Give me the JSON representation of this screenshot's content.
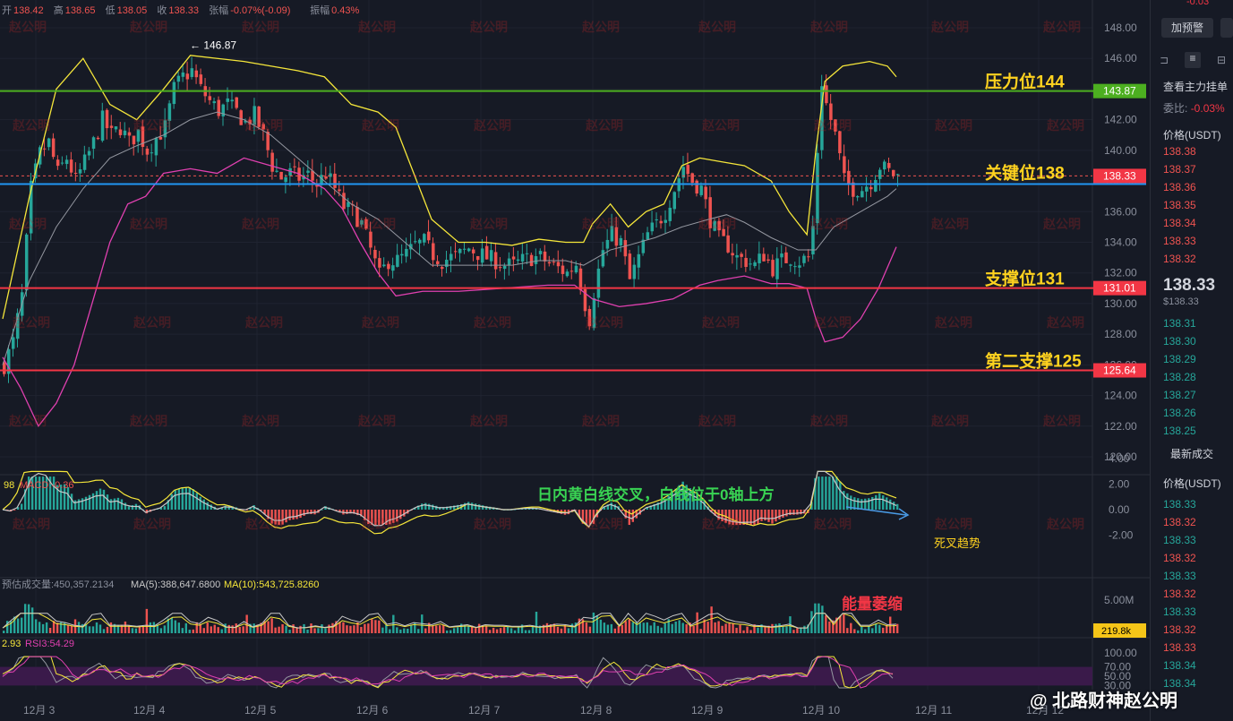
{
  "header": {
    "ohlc": [
      {
        "k": "开",
        "v": "138.42"
      },
      {
        "k": "高",
        "v": "138.65"
      },
      {
        "k": "低",
        "v": "138.05"
      },
      {
        "k": "收",
        "v": "138.33"
      },
      {
        "k": "张幅",
        "v": "-0.07%(-0.09)"
      },
      {
        "k": "振幅",
        "v": "0.43%"
      }
    ],
    "max_label": "146.87"
  },
  "annotations": {
    "resistance": "压力位144",
    "key": "关键位138",
    "support": "支撑位131",
    "support2": "第二支撑125",
    "macd_note": "日内黄白线交叉，白线位于0轴上方",
    "macd_death": "死叉趋势",
    "volume_note": "能量萎缩"
  },
  "price_axis": {
    "ticks": [
      "148.00",
      "146.00",
      "144.00",
      "142.00",
      "140.00",
      "138.00",
      "136.00",
      "134.00",
      "132.00",
      "130.00",
      "128.00",
      "126.00",
      "124.00",
      "122.00",
      "120.00"
    ],
    "tags": {
      "resistance": "143.87",
      "key": "138.33",
      "support": "131.01",
      "support2": "125.64"
    }
  },
  "macd": {
    "label_left": "98",
    "label": "MACD:-0.36",
    "ticks": [
      "4.00",
      "2.00",
      "0.00",
      "-2.00"
    ]
  },
  "volume": {
    "label_left": "预估成交量:450,357.2134",
    "ma5": "MA(5):388,647.6800",
    "ma10": "MA(10):543,725.8260",
    "ticks": [
      "5.00M"
    ],
    "tag": "219.8k"
  },
  "rsi": {
    "label_left": "2.93",
    "label": "RSI3:54.29",
    "ticks": [
      "100.00",
      "70.00",
      "50.00",
      "30.00"
    ]
  },
  "x_axis": [
    "12月 3",
    "12月 4",
    "12月 5",
    "12月 6",
    "12月 7",
    "12月 8",
    "12月 9",
    "12月 10",
    "12月 11",
    "12月 12"
  ],
  "watermark": "赵公明",
  "watermark_bottom": "@ 北路财神赵公明",
  "side": {
    "top_text": "-0.03",
    "alert_btn": "加预警",
    "depth_title": "查看主力挂单",
    "ratio_label": "委比:",
    "ratio_value": "-0.03%",
    "price_hdr": "价格(USDT)",
    "asks": [
      "138.38",
      "138.37",
      "138.36",
      "138.35",
      "138.34",
      "138.33",
      "138.32"
    ],
    "last": "138.33",
    "last_usd": "$138.33",
    "bids": [
      "138.31",
      "138.30",
      "138.29",
      "138.28",
      "138.27",
      "138.26",
      "138.25"
    ],
    "trades_title": "最新成交",
    "trades_hdr": "价格(USDT)",
    "trades": [
      {
        "p": "138.33",
        "c": "g"
      },
      {
        "p": "138.32",
        "c": "r"
      },
      {
        "p": "138.33",
        "c": "g"
      },
      {
        "p": "138.32",
        "c": "r"
      },
      {
        "p": "138.33",
        "c": "g"
      },
      {
        "p": "138.32",
        "c": "r"
      },
      {
        "p": "138.33",
        "c": "g"
      },
      {
        "p": "138.32",
        "c": "r"
      },
      {
        "p": "138.33",
        "c": "r"
      },
      {
        "p": "138.34",
        "c": "g"
      },
      {
        "p": "138.34",
        "c": "g"
      }
    ]
  },
  "chart_data": {
    "type": "candlestick",
    "y_range": [
      119,
      149
    ],
    "levels": [
      {
        "name": "压力位144",
        "value": 143.87,
        "color": "#4caf20"
      },
      {
        "name": "关键位138",
        "value": 137.8,
        "color": "#2196f3"
      },
      {
        "name": "支撑位131",
        "value": 131.01,
        "color": "#f23645"
      },
      {
        "name": "第二支撑125",
        "value": 125.64,
        "color": "#f23645"
      }
    ],
    "price_path": [
      [
        0,
        126.0
      ],
      [
        10,
        127.5
      ],
      [
        20,
        130.5
      ],
      [
        30,
        137.5
      ],
      [
        40,
        139.8
      ],
      [
        50,
        140.5
      ],
      [
        60,
        138.5
      ],
      [
        70,
        139.5
      ],
      [
        80,
        138.0
      ],
      [
        90,
        139.2
      ],
      [
        100,
        140.5
      ],
      [
        110,
        142.0
      ],
      [
        120,
        141.0
      ],
      [
        130,
        141.5
      ],
      [
        140,
        140.5
      ],
      [
        150,
        141.2
      ],
      [
        160,
        140.0
      ],
      [
        170,
        140.8
      ],
      [
        180,
        141.5
      ],
      [
        190,
        144.0
      ],
      [
        200,
        144.8
      ],
      [
        210,
        145.2
      ],
      [
        220,
        144.0
      ],
      [
        230,
        143.2
      ],
      [
        240,
        142.6
      ],
      [
        250,
        143.0
      ],
      [
        260,
        142.5
      ],
      [
        270,
        141.8
      ],
      [
        280,
        142.3
      ],
      [
        290,
        141.0
      ],
      [
        300,
        139.0
      ],
      [
        310,
        138.2
      ],
      [
        320,
        138.5
      ],
      [
        330,
        138.2
      ],
      [
        340,
        138.4
      ],
      [
        350,
        137.8
      ],
      [
        360,
        138.5
      ],
      [
        370,
        137.5
      ],
      [
        380,
        136.3
      ],
      [
        390,
        136.0
      ],
      [
        400,
        135.2
      ],
      [
        410,
        133.5
      ],
      [
        420,
        131.8
      ],
      [
        430,
        132.8
      ],
      [
        440,
        132.8
      ],
      [
        450,
        133.2
      ],
      [
        460,
        133.8
      ],
      [
        470,
        134.0
      ],
      [
        480,
        133.2
      ],
      [
        490,
        132.8
      ],
      [
        500,
        133.0
      ],
      [
        510,
        133.2
      ],
      [
        520,
        133.6
      ],
      [
        530,
        133.3
      ],
      [
        540,
        133.0
      ],
      [
        550,
        132.8
      ],
      [
        560,
        132.5
      ],
      [
        570,
        132.5
      ],
      [
        580,
        132.8
      ],
      [
        590,
        133.0
      ],
      [
        600,
        133.0
      ],
      [
        610,
        132.6
      ],
      [
        620,
        132.3
      ],
      [
        630,
        132.0
      ],
      [
        640,
        132.6
      ],
      [
        650,
        130.0
      ],
      [
        655,
        129.0
      ],
      [
        660,
        130.8
      ],
      [
        670,
        133.5
      ],
      [
        680,
        134.5
      ],
      [
        690,
        134.0
      ],
      [
        700,
        131.5
      ],
      [
        710,
        133.0
      ],
      [
        720,
        134.5
      ],
      [
        730,
        135.2
      ],
      [
        740,
        136.0
      ],
      [
        750,
        137.5
      ],
      [
        760,
        139.0
      ],
      [
        770,
        138.0
      ],
      [
        780,
        137.5
      ],
      [
        790,
        135.5
      ],
      [
        800,
        134.2
      ],
      [
        810,
        133.8
      ],
      [
        820,
        133.0
      ],
      [
        830,
        132.8
      ],
      [
        840,
        132.5
      ],
      [
        850,
        133.2
      ],
      [
        860,
        132.3
      ],
      [
        870,
        132.8
      ],
      [
        880,
        133.0
      ],
      [
        890,
        132.8
      ],
      [
        900,
        133.0
      ],
      [
        905,
        135.0
      ],
      [
        910,
        140.0
      ],
      [
        915,
        144.5
      ],
      [
        920,
        143.0
      ],
      [
        930,
        141.0
      ],
      [
        940,
        138.0
      ],
      [
        950,
        137.5
      ],
      [
        960,
        137.5
      ],
      [
        970,
        138.0
      ],
      [
        980,
        139.0
      ],
      [
        990,
        138.6
      ],
      [
        1000,
        138.3
      ]
    ],
    "bb_upper": [
      [
        0,
        129
      ],
      [
        30,
        137
      ],
      [
        60,
        144
      ],
      [
        90,
        146
      ],
      [
        120,
        143
      ],
      [
        150,
        142
      ],
      [
        180,
        144
      ],
      [
        210,
        146.2
      ],
      [
        240,
        146
      ],
      [
        270,
        145.8
      ],
      [
        300,
        145.5
      ],
      [
        330,
        145.2
      ],
      [
        360,
        144.8
      ],
      [
        390,
        143
      ],
      [
        420,
        142.5
      ],
      [
        440,
        141.5
      ],
      [
        460,
        138.5
      ],
      [
        480,
        135.5
      ],
      [
        510,
        134.0
      ],
      [
        540,
        134.0
      ],
      [
        570,
        133.8
      ],
      [
        600,
        134.2
      ],
      [
        630,
        134.0
      ],
      [
        650,
        134.0
      ],
      [
        660,
        135.2
      ],
      [
        680,
        136.5
      ],
      [
        700,
        135.0
      ],
      [
        720,
        136.0
      ],
      [
        740,
        136.5
      ],
      [
        760,
        139.0
      ],
      [
        780,
        139.5
      ],
      [
        800,
        139.3
      ],
      [
        830,
        139.0
      ],
      [
        860,
        138.0
      ],
      [
        880,
        136.0
      ],
      [
        900,
        134.5
      ],
      [
        910,
        140.0
      ],
      [
        920,
        144.5
      ],
      [
        940,
        145.5
      ],
      [
        970,
        145.8
      ],
      [
        990,
        145.5
      ],
      [
        1000,
        144.8
      ]
    ],
    "bb_lower": [
      [
        0,
        126.5
      ],
      [
        20,
        124.5
      ],
      [
        40,
        122.0
      ],
      [
        60,
        123.5
      ],
      [
        80,
        126.0
      ],
      [
        100,
        130.0
      ],
      [
        120,
        134.0
      ],
      [
        140,
        136.5
      ],
      [
        160,
        137.0
      ],
      [
        180,
        138.5
      ],
      [
        210,
        138.8
      ],
      [
        240,
        138.5
      ],
      [
        270,
        139.5
      ],
      [
        300,
        139.0
      ],
      [
        330,
        138.5
      ],
      [
        360,
        137.5
      ],
      [
        380,
        136.2
      ],
      [
        400,
        134.0
      ],
      [
        420,
        132.0
      ],
      [
        440,
        130.5
      ],
      [
        470,
        130.8
      ],
      [
        510,
        130.8
      ],
      [
        560,
        131.0
      ],
      [
        610,
        131.2
      ],
      [
        640,
        131.2
      ],
      [
        660,
        130.3
      ],
      [
        690,
        129.8
      ],
      [
        720,
        130.0
      ],
      [
        750,
        130.3
      ],
      [
        780,
        131.2
      ],
      [
        800,
        131.5
      ],
      [
        830,
        131.8
      ],
      [
        860,
        131.3
      ],
      [
        880,
        131.3
      ],
      [
        900,
        131.0
      ],
      [
        910,
        129.0
      ],
      [
        920,
        127.5
      ],
      [
        940,
        127.8
      ],
      [
        960,
        129.0
      ],
      [
        980,
        131.0
      ],
      [
        1000,
        133.7
      ]
    ],
    "bb_mid": [
      [
        0,
        126.0
      ],
      [
        30,
        131.5
      ],
      [
        60,
        135.0
      ],
      [
        90,
        137.5
      ],
      [
        120,
        139.5
      ],
      [
        150,
        140.3
      ],
      [
        180,
        141.0
      ],
      [
        210,
        142.0
      ],
      [
        240,
        142.5
      ],
      [
        270,
        142.0
      ],
      [
        300,
        141.0
      ],
      [
        330,
        139.5
      ],
      [
        360,
        138.0
      ],
      [
        390,
        136.5
      ],
      [
        420,
        135.5
      ],
      [
        450,
        134.0
      ],
      [
        480,
        132.5
      ],
      [
        510,
        132.5
      ],
      [
        540,
        132.5
      ],
      [
        570,
        132.5
      ],
      [
        600,
        132.8
      ],
      [
        630,
        132.8
      ],
      [
        650,
        132.5
      ],
      [
        680,
        133.5
      ],
      [
        700,
        133.8
      ],
      [
        730,
        134.3
      ],
      [
        760,
        135.0
      ],
      [
        790,
        135.5
      ],
      [
        810,
        135.8
      ],
      [
        830,
        135.3
      ],
      [
        860,
        134.3
      ],
      [
        890,
        133.5
      ],
      [
        910,
        133.5
      ],
      [
        930,
        135.0
      ],
      [
        960,
        136.0
      ],
      [
        990,
        137.0
      ],
      [
        1000,
        137.5
      ]
    ]
  }
}
